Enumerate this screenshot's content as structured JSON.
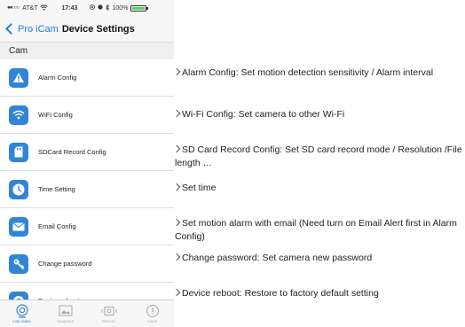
{
  "status_bar": {
    "signal": "●●○○○",
    "carrier": "AT&T",
    "time": "17:43",
    "battery_text": "100%"
  },
  "nav": {
    "back_label": "Pro iCam",
    "title": "Device Settings"
  },
  "section_header": "Cam",
  "menu": [
    {
      "label": "Alarm Config",
      "icon": "alert-triangle-icon"
    },
    {
      "label": "WiFi Config",
      "icon": "wifi-icon"
    },
    {
      "label": "SDCard Record Config",
      "icon": "sd-card-icon"
    },
    {
      "label": "Time Setting",
      "icon": "clock-icon"
    },
    {
      "label": "Email Config",
      "icon": "envelope-icon"
    },
    {
      "label": "Change password",
      "icon": "key-icon"
    },
    {
      "label": "Device reboot",
      "icon": "power-icon"
    }
  ],
  "tabs": [
    {
      "label": "Live video",
      "icon": "camera-icon",
      "active": true
    },
    {
      "label": "Snapshot",
      "icon": "image-icon",
      "active": false
    },
    {
      "label": "Record",
      "icon": "record-icon",
      "active": false
    },
    {
      "label": "Alarm",
      "icon": "alarm-icon",
      "active": false
    }
  ],
  "annotations": [
    "Alarm Config: Set motion detection sensitivity / Alarm interval",
    "Wi-Fi Config: Set camera to other Wi-Fi",
    "SD Card Record Config: Set SD card record mode / Resolution /File length …",
    "Set time",
    "Set motion alarm with email (Need turn on Email Alert first in Alarm Config)",
    "Change password: Set camera new password",
    "Device reboot: Restore to factory default setting"
  ],
  "colors": {
    "accent": "#1f7cf0",
    "icon_bg": "#2f85d6",
    "battery": "#4cd964"
  }
}
